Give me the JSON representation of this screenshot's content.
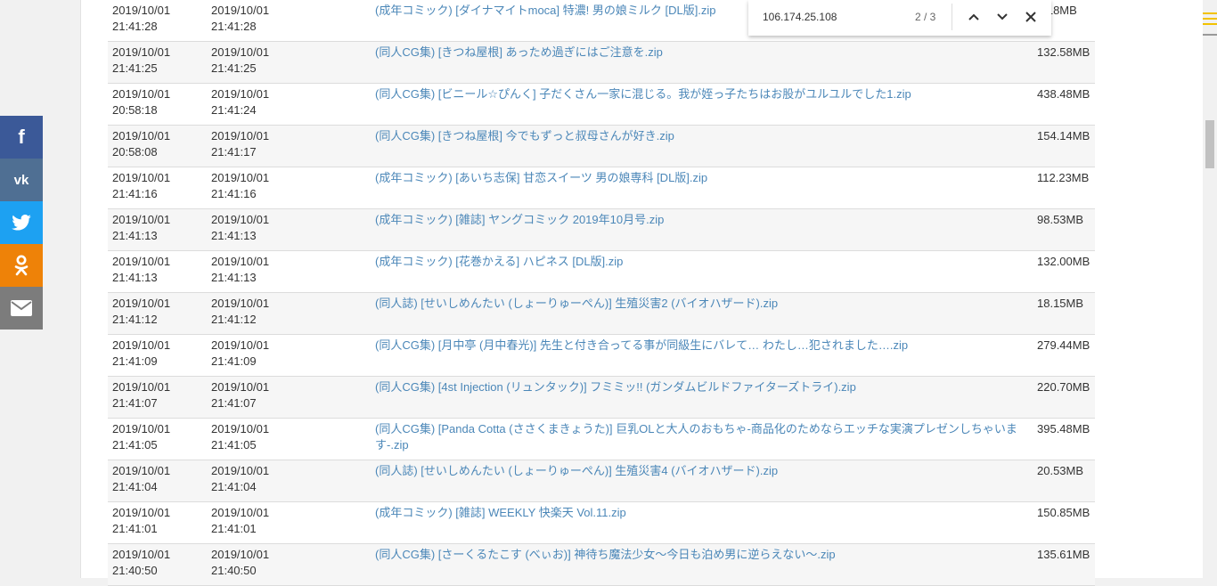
{
  "find": {
    "query": "106.174.25.108",
    "count": "2 / 3"
  },
  "rows": [
    {
      "d1": "2019/10/01",
      "t1": "21:41:28",
      "d2": "2019/10/01",
      "t2": "21:41:28",
      "title": "(成年コミック) [ダイナマイトmoca] 特濃! 男の娘ミルク [DL版].zip",
      "size": "7.18MB"
    },
    {
      "d1": "2019/10/01",
      "t1": "21:41:25",
      "d2": "2019/10/01",
      "t2": "21:41:25",
      "title": "(同人CG集) [きつね屋根] あっため過ぎにはご注意を.zip",
      "size": "132.58MB"
    },
    {
      "d1": "2019/10/01",
      "t1": "20:58:18",
      "d2": "2019/10/01",
      "t2": "21:41:24",
      "title": "(同人CG集) [ビニール☆ぴんく] 子だくさん一家に混じる。我が姪っ子たちはお股がユルユルでした1.zip",
      "size": "438.48MB"
    },
    {
      "d1": "2019/10/01",
      "t1": "20:58:08",
      "d2": "2019/10/01",
      "t2": "21:41:17",
      "title": "(同人CG集) [きつね屋根] 今でもずっと叔母さんが好き.zip",
      "size": "154.14MB"
    },
    {
      "d1": "2019/10/01",
      "t1": "21:41:16",
      "d2": "2019/10/01",
      "t2": "21:41:16",
      "title": "(成年コミック) [あいち志保] 甘恋スイーツ 男の娘専科 [DL版].zip",
      "size": "112.23MB"
    },
    {
      "d1": "2019/10/01",
      "t1": "21:41:13",
      "d2": "2019/10/01",
      "t2": "21:41:13",
      "title": "(成年コミック) [雑誌] ヤングコミック 2019年10月号.zip",
      "size": "98.53MB"
    },
    {
      "d1": "2019/10/01",
      "t1": "21:41:13",
      "d2": "2019/10/01",
      "t2": "21:41:13",
      "title": "(成年コミック) [花巻かえる] ハピネス [DL版].zip",
      "size": "132.00MB"
    },
    {
      "d1": "2019/10/01",
      "t1": "21:41:12",
      "d2": "2019/10/01",
      "t2": "21:41:12",
      "title": "(同人誌) [せいしめんたい (しょーりゅーぺん)] 生殖災害2 (バイオハザード).zip",
      "size": "18.15MB"
    },
    {
      "d1": "2019/10/01",
      "t1": "21:41:09",
      "d2": "2019/10/01",
      "t2": "21:41:09",
      "title": "(同人CG集) [月中亭 (月中春光)] 先生と付き合ってる事が同級生にバレて… わたし…犯されました….zip",
      "size": "279.44MB"
    },
    {
      "d1": "2019/10/01",
      "t1": "21:41:07",
      "d2": "2019/10/01",
      "t2": "21:41:07",
      "title": "(同人CG集) [4st Injection (リュンタック)] フミミッ!! (ガンダムビルドファイターズトライ).zip",
      "size": "220.70MB"
    },
    {
      "d1": "2019/10/01",
      "t1": "21:41:05",
      "d2": "2019/10/01",
      "t2": "21:41:05",
      "title": "(同人CG集) [Panda Cotta (ささくまきょうた)] 巨乳OLと大人のおもちゃ-商品化のためならエッチな実演プレゼンしちゃいます-.zip",
      "size": "395.48MB"
    },
    {
      "d1": "2019/10/01",
      "t1": "21:41:04",
      "d2": "2019/10/01",
      "t2": "21:41:04",
      "title": "(同人誌) [せいしめんたい (しょーりゅーぺん)] 生殖災害4 (バイオハザード).zip",
      "size": "20.53MB"
    },
    {
      "d1": "2019/10/01",
      "t1": "21:41:01",
      "d2": "2019/10/01",
      "t2": "21:41:01",
      "title": "(成年コミック) [雑誌] WEEKLY 快楽天 Vol.11.zip",
      "size": "150.85MB"
    },
    {
      "d1": "2019/10/01",
      "t1": "21:40:50",
      "d2": "2019/10/01",
      "t2": "21:40:50",
      "title": "(同人CG集) [さーくるたこす (べぃお)] 神待ち魔法少女～今日も泊め男に逆らえない～.zip",
      "size": "135.61MB"
    }
  ],
  "social": {
    "icons": [
      "facebook-icon",
      "vk-icon",
      "twitter-icon",
      "odnoklassniki-icon",
      "email-icon"
    ],
    "colors": [
      "#3b5998",
      "#4f6f93",
      "#1da1f2",
      "#ee8208",
      "#7c7c7c"
    ]
  },
  "colors": {
    "link": "#4b87b8",
    "row_alt": "#f6f6f6",
    "scroll_marker": "#f2c200"
  }
}
